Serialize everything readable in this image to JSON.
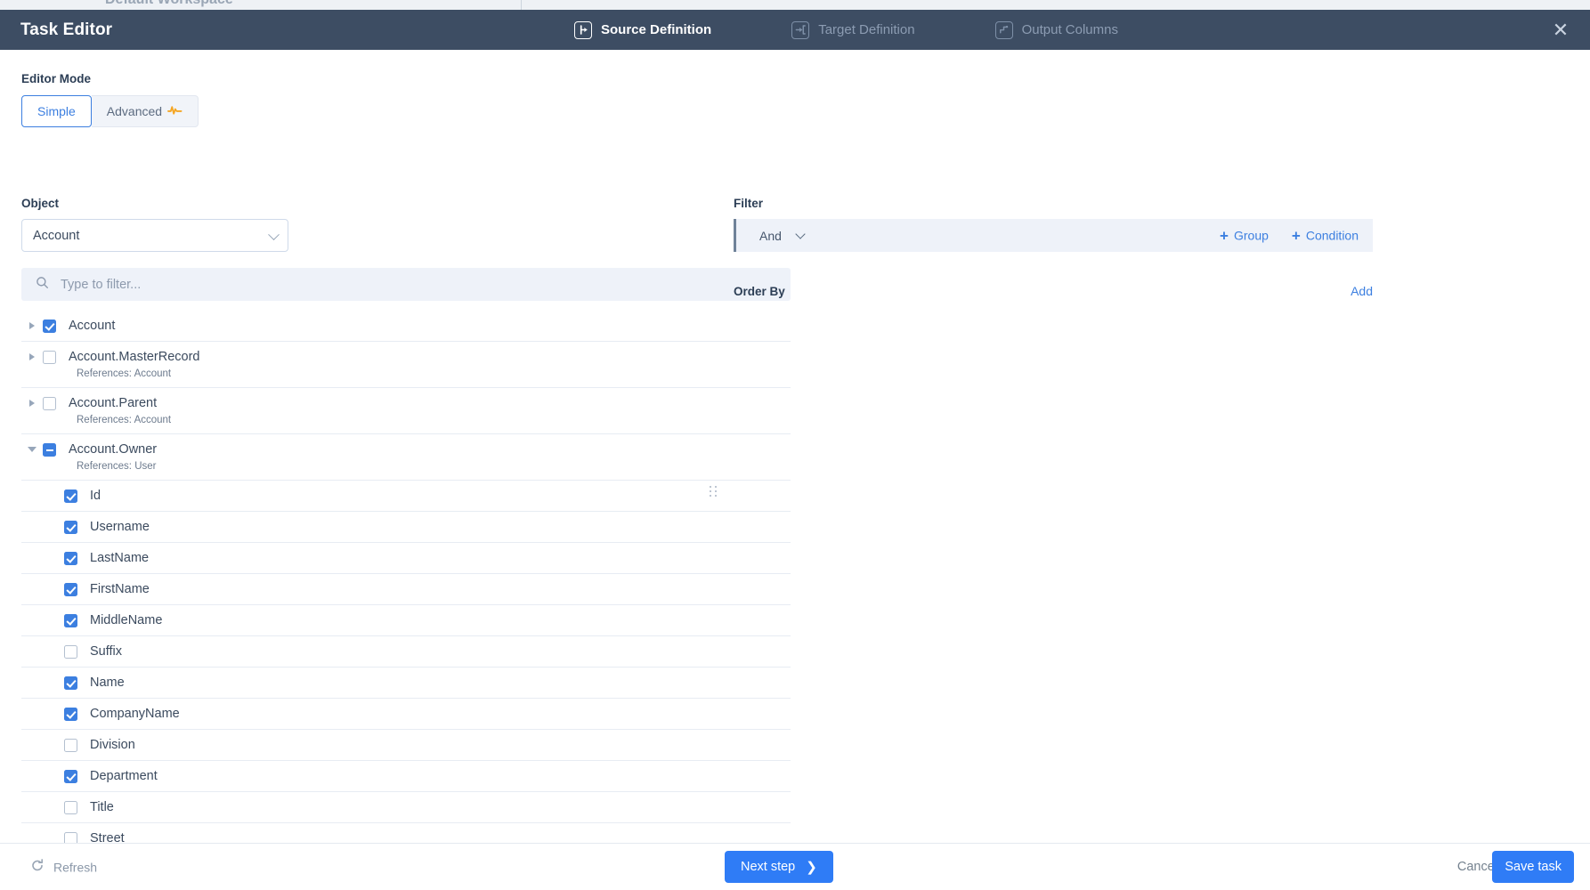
{
  "background": {
    "workspace_label": "Default Workspace"
  },
  "header": {
    "title": "Task Editor",
    "tabs": [
      {
        "label": "Source Definition",
        "icon": "source-definition-icon",
        "active": true
      },
      {
        "label": "Target Definition",
        "icon": "target-definition-icon",
        "active": false
      },
      {
        "label": "Output Columns",
        "icon": "output-columns-icon",
        "active": false
      }
    ],
    "close_icon": "close-icon"
  },
  "editor_mode": {
    "label": "Editor Mode",
    "options": [
      {
        "label": "Simple",
        "active": true
      },
      {
        "label": "Advanced",
        "active": false,
        "icon": "pulse-icon"
      }
    ]
  },
  "object": {
    "label": "Object",
    "value": "Account",
    "caret_icon": "chevron-down-icon"
  },
  "tree_filter": {
    "placeholder": "Type to filter...",
    "value": "",
    "icon": "search-icon"
  },
  "tree": [
    {
      "label": "Account",
      "state": "checked",
      "twisty": "collapsed",
      "level": 0,
      "sub": ""
    },
    {
      "label": "Account.MasterRecord",
      "state": "unchecked",
      "twisty": "collapsed",
      "level": 0,
      "sub": "References: Account"
    },
    {
      "label": "Account.Parent",
      "state": "unchecked",
      "twisty": "collapsed",
      "level": 0,
      "sub": "References: Account"
    },
    {
      "label": "Account.Owner",
      "state": "indeterminate",
      "twisty": "expanded",
      "level": 0,
      "sub": "References: User"
    },
    {
      "label": "Id",
      "state": "checked",
      "twisty": "none",
      "level": 1,
      "sub": ""
    },
    {
      "label": "Username",
      "state": "checked",
      "twisty": "none",
      "level": 1,
      "sub": ""
    },
    {
      "label": "LastName",
      "state": "checked",
      "twisty": "none",
      "level": 1,
      "sub": ""
    },
    {
      "label": "FirstName",
      "state": "checked",
      "twisty": "none",
      "level": 1,
      "sub": ""
    },
    {
      "label": "MiddleName",
      "state": "checked",
      "twisty": "none",
      "level": 1,
      "sub": ""
    },
    {
      "label": "Suffix",
      "state": "unchecked",
      "twisty": "none",
      "level": 1,
      "sub": ""
    },
    {
      "label": "Name",
      "state": "checked",
      "twisty": "none",
      "level": 1,
      "sub": ""
    },
    {
      "label": "CompanyName",
      "state": "checked",
      "twisty": "none",
      "level": 1,
      "sub": ""
    },
    {
      "label": "Division",
      "state": "unchecked",
      "twisty": "none",
      "level": 1,
      "sub": ""
    },
    {
      "label": "Department",
      "state": "checked",
      "twisty": "none",
      "level": 1,
      "sub": ""
    },
    {
      "label": "Title",
      "state": "unchecked",
      "twisty": "none",
      "level": 1,
      "sub": ""
    },
    {
      "label": "Street",
      "state": "unchecked",
      "twisty": "none",
      "level": 1,
      "sub": ""
    }
  ],
  "filter": {
    "label": "Filter",
    "operator": "And",
    "add_group_label": "Group",
    "add_condition_label": "Condition"
  },
  "order_by": {
    "label": "Order By",
    "add_label": "Add"
  },
  "footer": {
    "refresh_label": "Refresh",
    "refresh_icon": "refresh-icon",
    "next_label": "Next step",
    "next_icon": "chevron-right-icon",
    "cancel_label": "Cancel",
    "save_label": "Save task"
  },
  "colors": {
    "header_bg": "#3d4d63",
    "accent": "#3c7fe0",
    "primary_button": "#2f7cf6",
    "advanced_icon": "#f5a623"
  }
}
